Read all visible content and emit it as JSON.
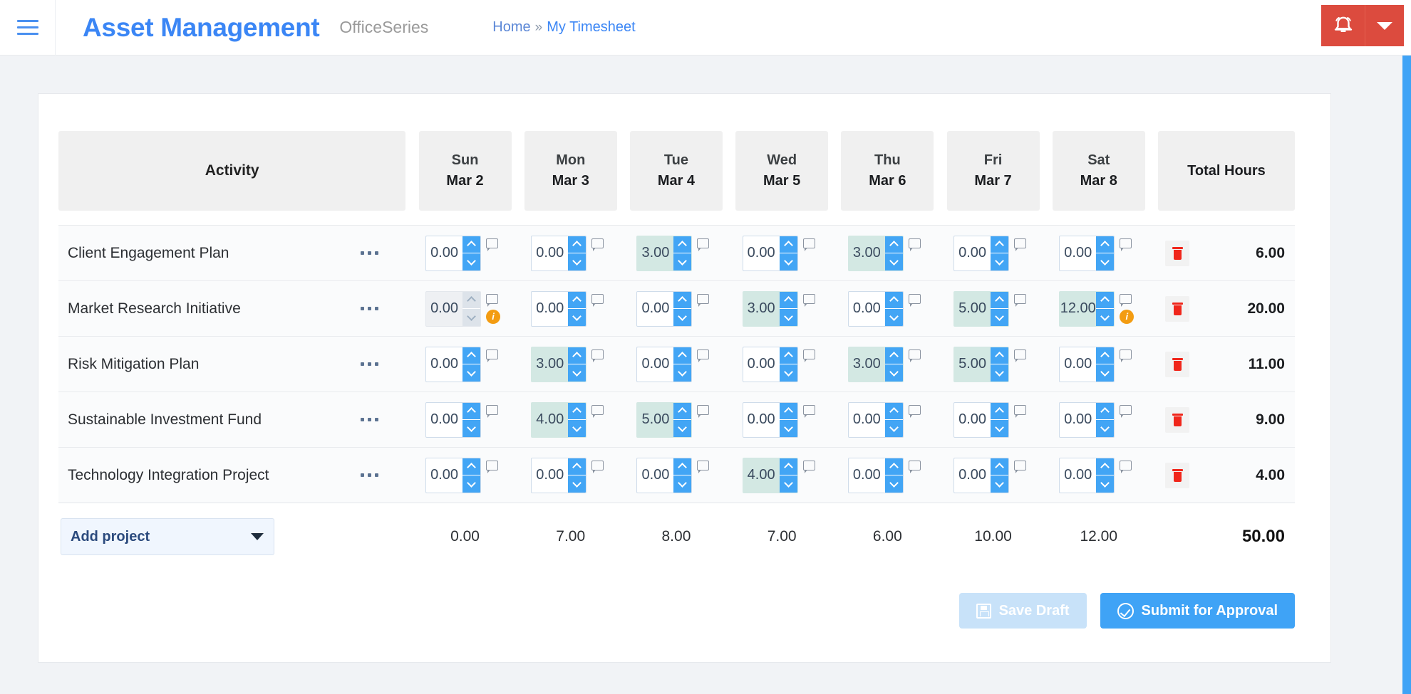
{
  "header": {
    "menu_icon": "hamburger-icon",
    "brand": "Asset Management",
    "suite": "OfficeSeries",
    "breadcrumb": {
      "home": "Home",
      "separator": "»",
      "current": "My Timesheet"
    },
    "notification_icon": "alarm-bell-icon",
    "dropdown_icon": "chevron-down-icon",
    "accent_red": "#dc4b3e",
    "accent_blue": "#3b86f5"
  },
  "table": {
    "activity_header": "Activity",
    "total_header": "Total Hours",
    "days": [
      {
        "dow": "Sun",
        "date": "Mar 2"
      },
      {
        "dow": "Mon",
        "date": "Mar 3"
      },
      {
        "dow": "Tue",
        "date": "Mar 4"
      },
      {
        "dow": "Wed",
        "date": "Mar 5"
      },
      {
        "dow": "Thu",
        "date": "Mar 6"
      },
      {
        "dow": "Fri",
        "date": "Mar 7"
      },
      {
        "dow": "Sat",
        "date": "Mar 8"
      }
    ],
    "rows": [
      {
        "activity": "Client Engagement Plan",
        "total": "6.00",
        "cells": [
          {
            "value": "0.00",
            "highlight": false,
            "disabled": false,
            "warning": false
          },
          {
            "value": "0.00",
            "highlight": false,
            "disabled": false,
            "warning": false
          },
          {
            "value": "3.00",
            "highlight": true,
            "disabled": false,
            "warning": false
          },
          {
            "value": "0.00",
            "highlight": false,
            "disabled": false,
            "warning": false
          },
          {
            "value": "3.00",
            "highlight": true,
            "disabled": false,
            "warning": false
          },
          {
            "value": "0.00",
            "highlight": false,
            "disabled": false,
            "warning": false
          },
          {
            "value": "0.00",
            "highlight": false,
            "disabled": false,
            "warning": false
          }
        ]
      },
      {
        "activity": "Market Research Initiative",
        "total": "20.00",
        "cells": [
          {
            "value": "0.00",
            "highlight": false,
            "disabled": true,
            "warning": true
          },
          {
            "value": "0.00",
            "highlight": false,
            "disabled": false,
            "warning": false
          },
          {
            "value": "0.00",
            "highlight": false,
            "disabled": false,
            "warning": false
          },
          {
            "value": "3.00",
            "highlight": true,
            "disabled": false,
            "warning": false
          },
          {
            "value": "0.00",
            "highlight": false,
            "disabled": false,
            "warning": false
          },
          {
            "value": "5.00",
            "highlight": true,
            "disabled": false,
            "warning": false
          },
          {
            "value": "12.00",
            "highlight": true,
            "disabled": false,
            "warning": true
          }
        ]
      },
      {
        "activity": "Risk Mitigation Plan",
        "total": "11.00",
        "cells": [
          {
            "value": "0.00",
            "highlight": false,
            "disabled": false,
            "warning": false
          },
          {
            "value": "3.00",
            "highlight": true,
            "disabled": false,
            "warning": false
          },
          {
            "value": "0.00",
            "highlight": false,
            "disabled": false,
            "warning": false
          },
          {
            "value": "0.00",
            "highlight": false,
            "disabled": false,
            "warning": false
          },
          {
            "value": "3.00",
            "highlight": true,
            "disabled": false,
            "warning": false
          },
          {
            "value": "5.00",
            "highlight": true,
            "disabled": false,
            "warning": false
          },
          {
            "value": "0.00",
            "highlight": false,
            "disabled": false,
            "warning": false
          }
        ]
      },
      {
        "activity": "Sustainable Investment Fund",
        "total": "9.00",
        "cells": [
          {
            "value": "0.00",
            "highlight": false,
            "disabled": false,
            "warning": false
          },
          {
            "value": "4.00",
            "highlight": true,
            "disabled": false,
            "warning": false
          },
          {
            "value": "5.00",
            "highlight": true,
            "disabled": false,
            "warning": false
          },
          {
            "value": "0.00",
            "highlight": false,
            "disabled": false,
            "warning": false
          },
          {
            "value": "0.00",
            "highlight": false,
            "disabled": false,
            "warning": false
          },
          {
            "value": "0.00",
            "highlight": false,
            "disabled": false,
            "warning": false
          },
          {
            "value": "0.00",
            "highlight": false,
            "disabled": false,
            "warning": false
          }
        ]
      },
      {
        "activity": "Technology Integration Project",
        "total": "4.00",
        "cells": [
          {
            "value": "0.00",
            "highlight": false,
            "disabled": false,
            "warning": false
          },
          {
            "value": "0.00",
            "highlight": false,
            "disabled": false,
            "warning": false
          },
          {
            "value": "0.00",
            "highlight": false,
            "disabled": false,
            "warning": false
          },
          {
            "value": "4.00",
            "highlight": true,
            "disabled": false,
            "warning": false
          },
          {
            "value": "0.00",
            "highlight": false,
            "disabled": false,
            "warning": false
          },
          {
            "value": "0.00",
            "highlight": false,
            "disabled": false,
            "warning": false
          },
          {
            "value": "0.00",
            "highlight": false,
            "disabled": false,
            "warning": false
          }
        ]
      }
    ],
    "totals": {
      "per_day": [
        "0.00",
        "7.00",
        "8.00",
        "7.00",
        "6.00",
        "10.00",
        "12.00"
      ],
      "grand": "50.00"
    },
    "add_project_label": "Add project",
    "row_menu_icon": "ellipsis-icon",
    "note_icon": "comment-icon",
    "warning_icon": "info-badge-icon",
    "delete_icon": "trash-icon",
    "highlight_color": "#d3e8e3",
    "spinner_color": "#42a5f5",
    "warning_color": "#f39c12",
    "delete_color": "#f0261b"
  },
  "actions": {
    "save_draft": "Save Draft",
    "save_draft_icon": "floppy-disk-icon",
    "save_draft_disabled": true,
    "submit": "Submit for Approval",
    "submit_icon": "check-circle-icon"
  }
}
